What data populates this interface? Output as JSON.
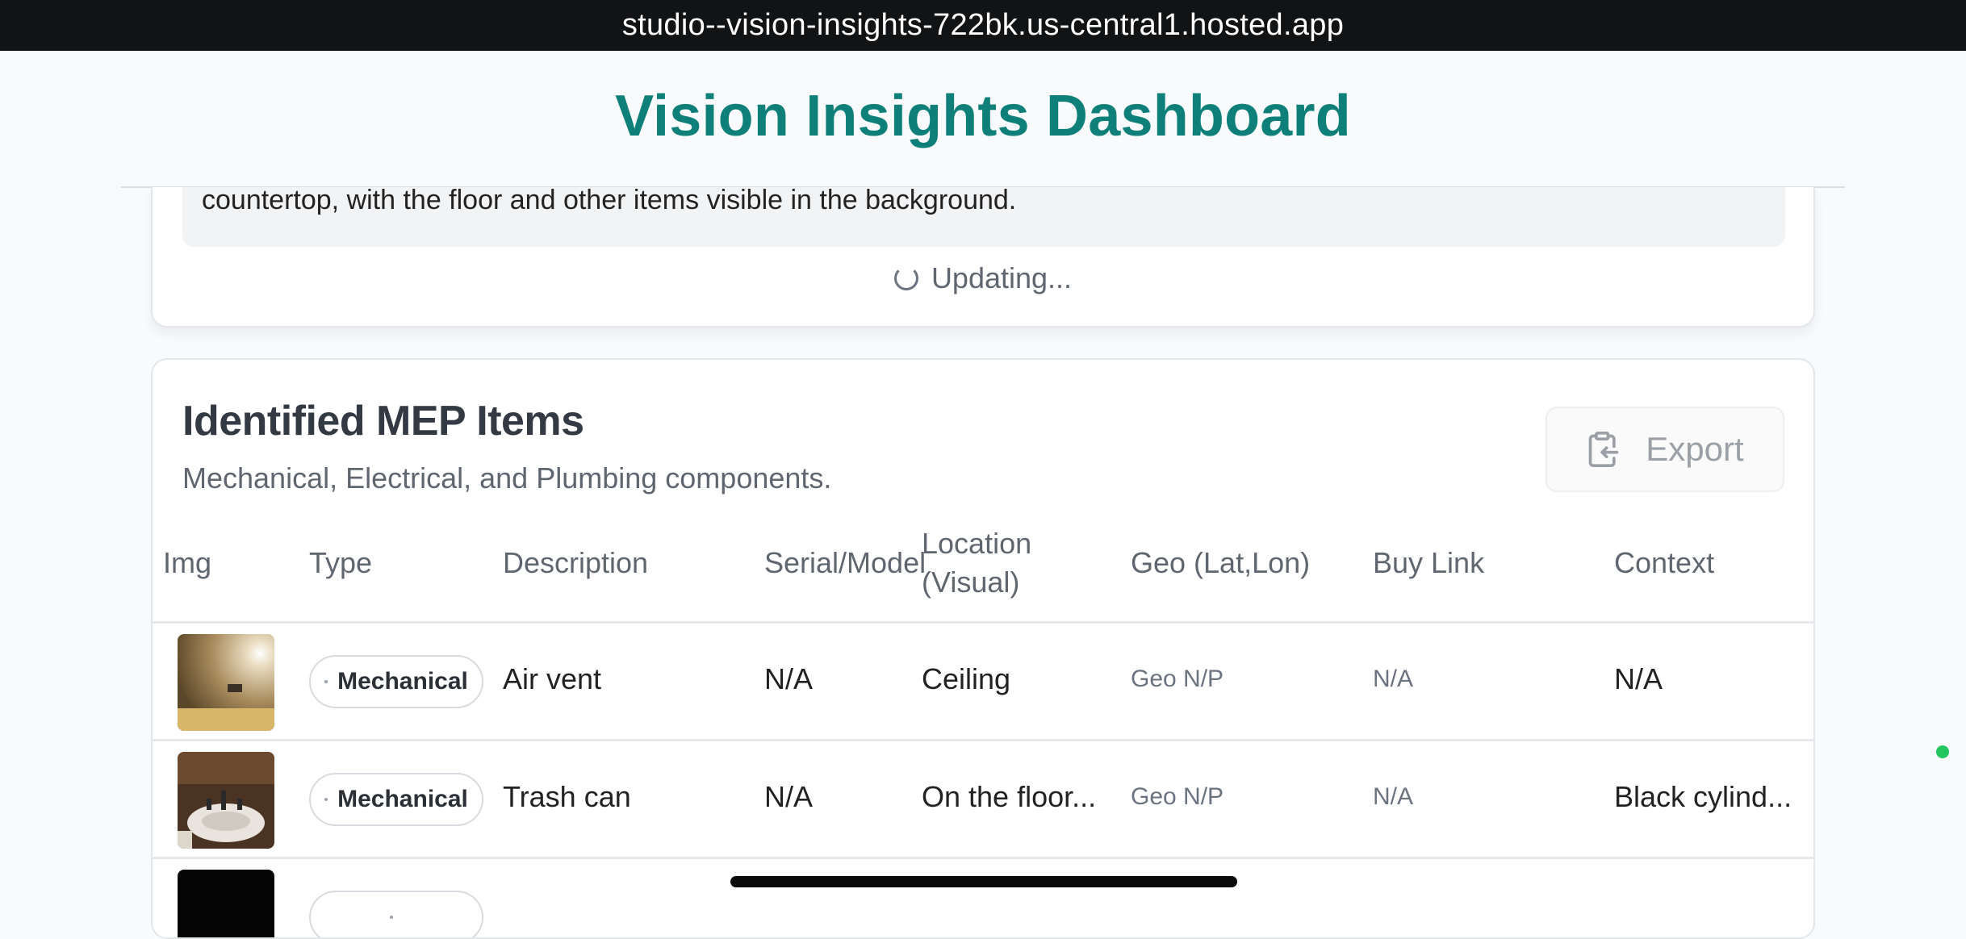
{
  "browser": {
    "url": "studio--vision-insights-722bk.us-central1.hosted.app"
  },
  "app": {
    "title": "Vision Insights Dashboard"
  },
  "summary": {
    "text": "countertop, with the floor and other items visible in the background.",
    "status": "Updating..."
  },
  "mep": {
    "title": "Identified MEP Items",
    "subtitle": "Mechanical, Electrical, and Plumbing components.",
    "export_label": "Export",
    "columns": {
      "img": "Img",
      "type": "Type",
      "description": "Description",
      "serial": "Serial/Model",
      "location_1": "Location",
      "location_2": "(Visual)",
      "geo": "Geo (Lat,Lon)",
      "buy": "Buy Link",
      "context": "Context"
    },
    "rows": [
      {
        "type": "Mechanical",
        "description": "Air vent",
        "serial": "N/A",
        "location": "Ceiling",
        "geo": "Geo N/P",
        "buy": "N/A",
        "context": "N/A"
      },
      {
        "type": "Mechanical",
        "description": "Trash can",
        "serial": "N/A",
        "location": "On the floor...",
        "geo": "Geo N/P",
        "buy": "N/A",
        "context": "Black cylind..."
      }
    ]
  },
  "colors": {
    "brand": "#0f8079",
    "status_dot": "#22c55e"
  }
}
